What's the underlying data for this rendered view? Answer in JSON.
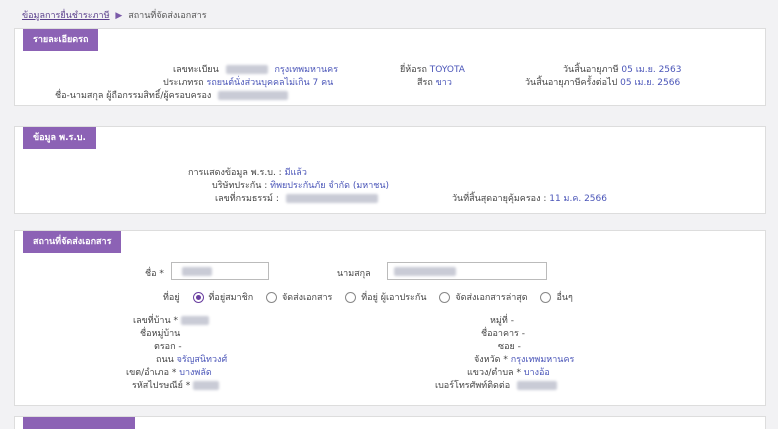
{
  "breadcrumb": {
    "link": "ข้อมูลการยื่นชำระภาษี",
    "separator": "▶",
    "current": "สถานที่จัดส่งเอกสาร"
  },
  "vehicle": {
    "title": "รายละเอียดรถ",
    "reg_label": "เลขทะเบียน",
    "reg_province": "กรุงเทพมหานคร",
    "type_label": "ประเภทรถ",
    "type_value": "รถยนต์นั่งส่วนบุคคลไม่เกิน 7 คน",
    "owner_label": "ชื่อ-นามสกุล ผู้ถือกรรมสิทธิ์/ผู้ครอบครอง",
    "brand_label": "ยี่ห้อรถ",
    "brand_value": "TOYOTA",
    "color_label": "สีรถ",
    "color_value": "ขาว",
    "tax_expiry_label": "วันสิ้นอายุภาษี",
    "tax_expiry_value": "05 เม.ย. 2563",
    "next_expiry_label": "วันสิ้นอายุภาษีครั้งต่อไป",
    "next_expiry_value": "05 เม.ย. 2566"
  },
  "insurance": {
    "title": "ข้อมูล พ.ร.บ.",
    "display_label": "การแสดงข้อมูล พ.ร.บ. :",
    "display_value": "มีแล้ว",
    "company_label": "บริษัทประกัน :",
    "company_value": "ทิพยประกันภัย จำกัด (มหาชน)",
    "policy_label": "เลขที่กรมธรรม์ :",
    "coverage_label": "วันที่สิ้นสุดอายุคุ้มครอง :",
    "coverage_value": "11 ม.ค. 2566"
  },
  "delivery": {
    "title": "สถานที่จัดส่งเอกสาร",
    "name_label": "ชื่อ",
    "surname_label": "นามสกุล",
    "required": "*",
    "address_label": "ที่อยู่",
    "options": [
      "ที่อยู่สมาชิก",
      "จัดส่งเอกสาร",
      "ที่อยู่ ผู้เอาประกัน",
      "จัดส่งเอกสารล่าสุด",
      "อื่นๆ"
    ],
    "house_no_label": "เลขที่บ้าน",
    "village_label": "ชื่อหมู่บ้าน",
    "alley_label": "ตรอก",
    "road_label": "ถนน",
    "road_value": "จรัญสนิทวงศ์",
    "district_label": "เขต/อำเภอ",
    "district_value": "บางพลัด",
    "postal_label": "รหัสไปรษณีย์",
    "moo_label": "หมู่ที่",
    "building_label": "ชื่ออาคาร",
    "soi_label": "ซอย",
    "province_label": "จังหวัด",
    "province_value": "กรุงเทพมหานคร",
    "subdistrict_label": "แขวง/ตำบล",
    "subdistrict_value": "บางอ้อ",
    "phone_label": "เบอร์โทรศัพท์ติดต่อ",
    "dash": "-"
  }
}
